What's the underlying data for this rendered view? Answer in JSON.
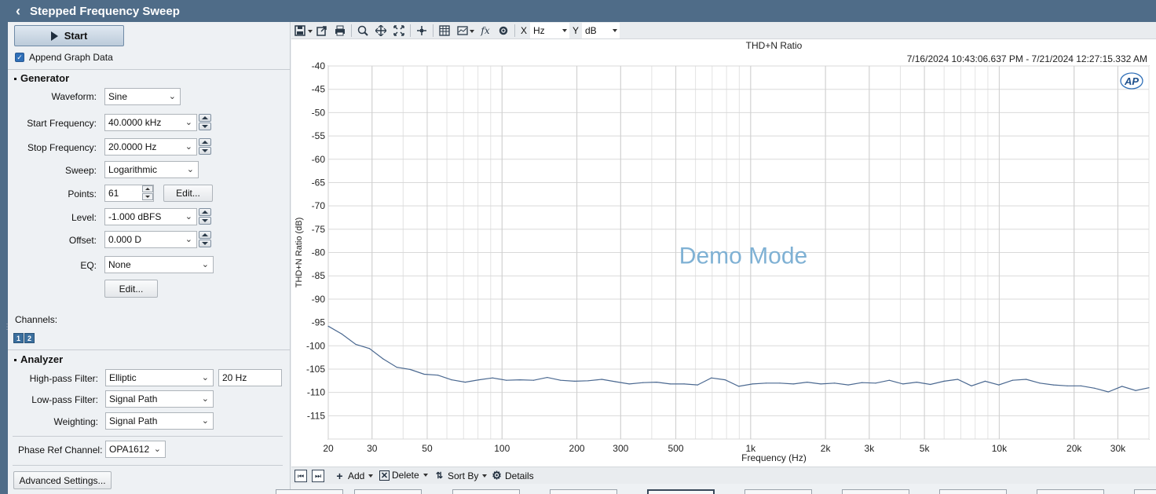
{
  "title": "Stepped Frequency Sweep",
  "start_label": "Start",
  "append_label": "Append Graph Data",
  "generator": {
    "heading": "Generator",
    "waveform_label": "Waveform:",
    "waveform_value": "Sine",
    "start_freq_label": "Start Frequency:",
    "start_freq_value": "40.0000 kHz",
    "stop_freq_label": "Stop Frequency:",
    "stop_freq_value": "20.0000 Hz",
    "sweep_label": "Sweep:",
    "sweep_value": "Logarithmic",
    "points_label": "Points:",
    "points_value": "61",
    "points_edit": "Edit...",
    "level_label": "Level:",
    "level_value": "-1.000 dBFS",
    "offset_label": "Offset:",
    "offset_value": "0.000 D",
    "eq_label": "EQ:",
    "eq_value": "None",
    "eq_edit": "Edit..."
  },
  "channels": {
    "label": "Channels:",
    "ch1": "1",
    "ch2": "2"
  },
  "analyzer": {
    "heading": "Analyzer",
    "hpf_label": "High-pass Filter:",
    "hpf_value": "Elliptic",
    "hpf_freq": "20 Hz",
    "lpf_label": "Low-pass Filter:",
    "lpf_value": "Signal Path",
    "weighting_label": "Weighting:",
    "weighting_value": "Signal Path"
  },
  "phase_ref": {
    "label": "Phase Ref Channel:",
    "value": "OPA1612"
  },
  "advanced_label": "Advanced Settings...",
  "toolbar": {
    "x_label": "X",
    "x_unit": "Hz",
    "y_label": "Y",
    "y_unit": "dB",
    "icons": [
      "save-icon",
      "export-icon",
      "print-icon",
      "zoom-icon",
      "pan-icon",
      "fit-icon",
      "cursor-icon",
      "table-icon",
      "display-icon",
      "function-icon",
      "settings-icon"
    ]
  },
  "watermark": "Demo Mode",
  "logo": "AP",
  "bottombar": {
    "add": "Add",
    "delete": "Delete",
    "sort_by": "Sort By",
    "details": "Details"
  },
  "colors": {
    "header": "#4f6c88",
    "trace": "#4a6890",
    "watermark": "#7fb1d4"
  },
  "chart_data": {
    "type": "line",
    "title": "THD+N Ratio",
    "subtitle": "7/16/2024 10:43:06.637 PM - 7/21/2024 12:27:15.332 AM",
    "xlabel": "Frequency (Hz)",
    "ylabel": "THD+N Ratio (dB)",
    "x_scale": "log",
    "xlim": [
      20,
      40000
    ],
    "ylim": [
      -120,
      -40
    ],
    "x_ticks": [
      20,
      30,
      50,
      100,
      200,
      300,
      500,
      1000,
      2000,
      3000,
      5000,
      10000,
      20000,
      30000
    ],
    "x_tick_labels": [
      "20",
      "30",
      "50",
      "100",
      "200",
      "300",
      "500",
      "1k",
      "2k",
      "3k",
      "5k",
      "10k",
      "20k",
      "30k"
    ],
    "y_ticks": [
      -40,
      -45,
      -50,
      -55,
      -60,
      -65,
      -70,
      -75,
      -80,
      -85,
      -90,
      -95,
      -100,
      -105,
      -110,
      -115
    ],
    "y_tick_labels": [
      "-40",
      "-45",
      "-50",
      "-55",
      "-60",
      "-65",
      "-70",
      "-75",
      "-80",
      "-85",
      "-90",
      "-95",
      "-100",
      "-105",
      "-110",
      "-115"
    ],
    "grid": true,
    "series": [
      {
        "x": [
          20,
          22.7,
          25.8,
          29.3,
          33.2,
          37.7,
          42.8,
          48.6,
          55.2,
          62.6,
          71.1,
          80.7,
          91.6,
          104,
          118,
          134,
          152,
          172,
          196,
          222,
          252,
          286,
          325,
          369,
          419,
          475,
          540,
          612,
          695,
          789,
          896,
          1017,
          1154,
          1310,
          1487,
          1688,
          1916,
          2175,
          2469,
          2803,
          3182,
          3612,
          4100,
          4654,
          5283,
          5998,
          6808,
          7728,
          8773,
          9958,
          11304,
          12832,
          14566,
          16534,
          18768,
          21304,
          24184,
          27452,
          31162,
          35372,
          40000
        ],
        "y": [
          -95.8,
          -97.5,
          -99.7,
          -100.6,
          -102.8,
          -104.6,
          -105.1,
          -106.1,
          -106.3,
          -107.3,
          -107.8,
          -107.3,
          -106.9,
          -107.4,
          -107.3,
          -107.4,
          -106.8,
          -107.4,
          -107.6,
          -107.5,
          -107.2,
          -107.7,
          -108.2,
          -107.9,
          -107.8,
          -108.2,
          -108.2,
          -108.4,
          -106.9,
          -107.3,
          -108.7,
          -108.2,
          -108.0,
          -108.0,
          -108.2,
          -107.8,
          -108.2,
          -108.0,
          -108.4,
          -107.9,
          -108.0,
          -107.4,
          -108.2,
          -107.8,
          -108.3,
          -107.6,
          -107.2,
          -108.6,
          -107.6,
          -108.4,
          -107.4,
          -107.2,
          -108.0,
          -108.4,
          -108.6,
          -108.6,
          -109.1,
          -109.9,
          -108.7,
          -109.6,
          -109.0
        ]
      }
    ]
  }
}
